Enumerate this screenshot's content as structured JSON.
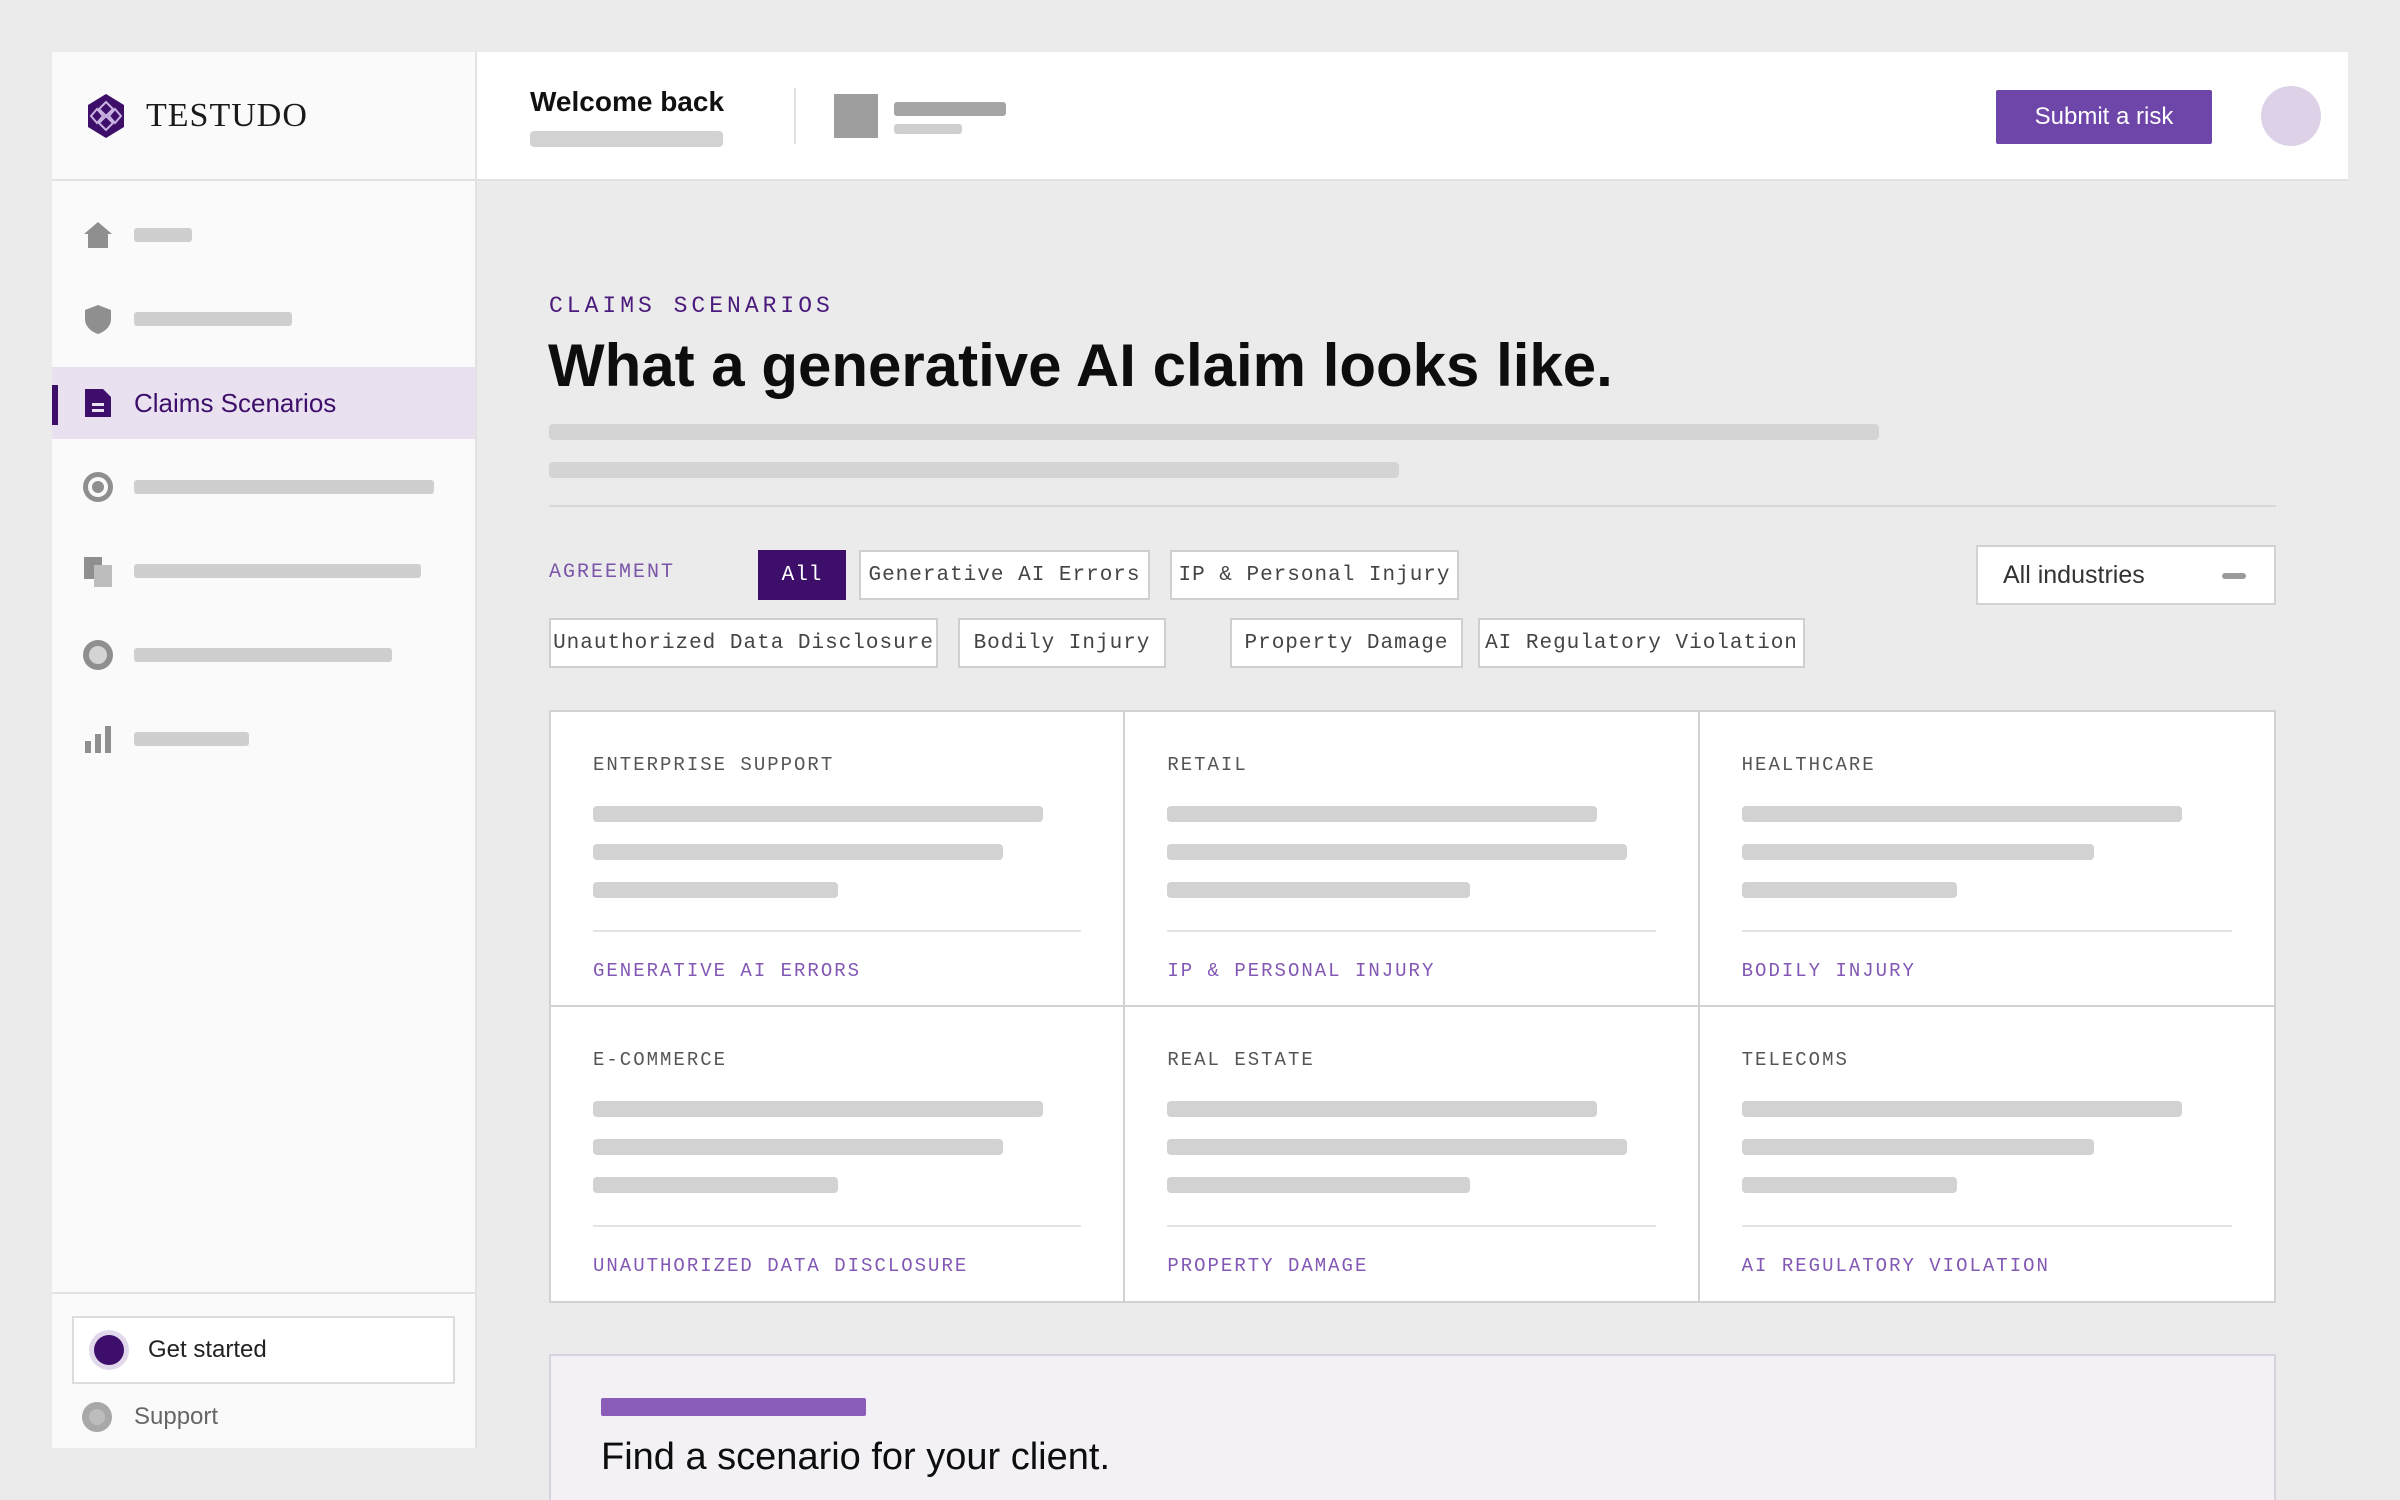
{
  "brand": {
    "name": "TESTUDO",
    "accent": "#6e45a8",
    "dark_accent": "#3d0f6b"
  },
  "header": {
    "welcome": "Welcome back",
    "submit_label": "Submit a risk"
  },
  "sidebar": {
    "items": [
      {
        "icon": "home-icon",
        "label": ""
      },
      {
        "icon": "shield-icon",
        "label": ""
      },
      {
        "icon": "document-icon",
        "label": "Claims Scenarios",
        "active": true
      },
      {
        "icon": "target-icon",
        "label": ""
      },
      {
        "icon": "copy-icon",
        "label": ""
      },
      {
        "icon": "circle-icon",
        "label": ""
      },
      {
        "icon": "bar-chart-icon",
        "label": ""
      }
    ],
    "get_started": "Get started",
    "support": "Support"
  },
  "main": {
    "eyebrow": "CLAIMS SCENARIOS",
    "title": "What a generative AI claim looks like.",
    "filter_label": "AGREEMENT",
    "chips": [
      "All",
      "Generative AI Errors",
      "IP & Personal Injury",
      "Unauthorized Data Disclosure",
      "Bodily Injury",
      "Property Damage",
      "AI Regulatory Violation"
    ],
    "active_chip": "All",
    "industry_select": "All industries",
    "cards": [
      {
        "industry": "ENTERPRISE SUPPORT",
        "tag": "GENERATIVE AI ERRORS"
      },
      {
        "industry": "RETAIL",
        "tag": "IP & PERSONAL INJURY"
      },
      {
        "industry": "HEALTHCARE",
        "tag": "BODILY INJURY"
      },
      {
        "industry": "E-COMMERCE",
        "tag": "UNAUTHORIZED DATA DISCLOSURE"
      },
      {
        "industry": "REAL ESTATE",
        "tag": "PROPERTY DAMAGE"
      },
      {
        "industry": "TELECOMS",
        "tag": "AI REGULATORY VIOLATION"
      }
    ],
    "callout_title": "Find a scenario for your client."
  }
}
